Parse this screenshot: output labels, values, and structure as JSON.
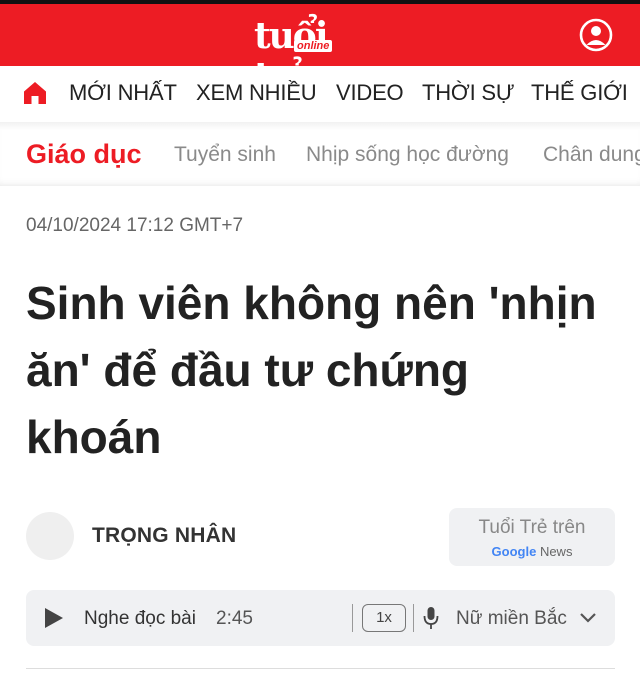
{
  "header": {
    "logo_text": "tuổi trẻ",
    "logo_sub": "online",
    "brand_color": "#ed1c24",
    "user_icon": "user-circle-icon"
  },
  "nav": {
    "home_icon": "home-icon",
    "items": [
      "MỚI NHẤT",
      "XEM NHIỀU",
      "VIDEO",
      "THỜI SỰ",
      "THẾ GIỚI"
    ]
  },
  "subnav": {
    "category": "Giáo dục",
    "items": [
      "Tuyển sinh",
      "Nhịp sống học đường",
      "Chân dung"
    ]
  },
  "article": {
    "date": "04/10/2024 17:12 GMT+7",
    "headline": "Sinh viên không nên 'nhịn ăn' để đầu tư chứng khoán",
    "author": "TRỌNG NHÂN"
  },
  "google_news": {
    "line1": "Tuổi Trẻ trên",
    "brand": "Google",
    "product": "News"
  },
  "player": {
    "label": "Nghe đọc bài",
    "duration": "2:45",
    "speed": "1x",
    "voice": "Nữ miền Bắc"
  }
}
